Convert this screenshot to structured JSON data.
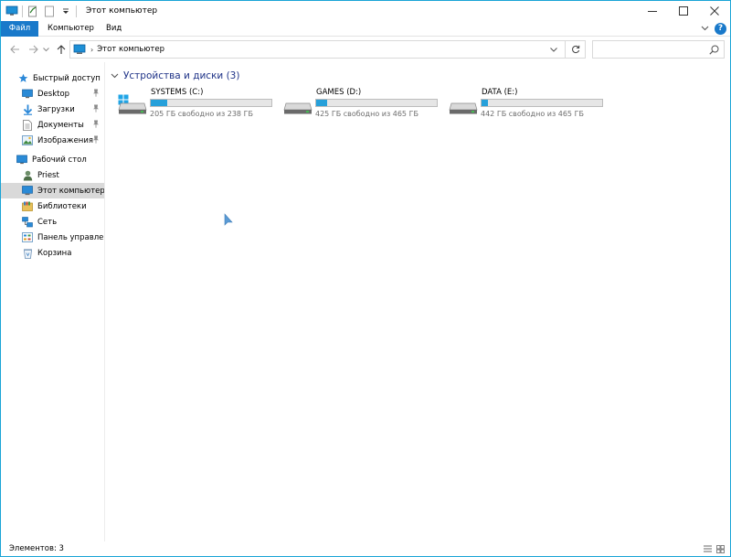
{
  "window": {
    "title": "Этот компьютер",
    "accent": "#1979ca"
  },
  "ribbon": {
    "tabs": [
      "Файл",
      "Компьютер",
      "Вид"
    ],
    "help_label": "?"
  },
  "address": {
    "breadcrumb": "Этот компьютер",
    "search_placeholder": ""
  },
  "sidebar": {
    "quick_access": "Быстрый доступ",
    "items": [
      {
        "label": "Desktop",
        "icon": "desktop-icon",
        "pinned": true
      },
      {
        "label": "Загрузки",
        "icon": "downloads-icon",
        "pinned": true
      },
      {
        "label": "Документы",
        "icon": "documents-icon",
        "pinned": true
      },
      {
        "label": "Изображения",
        "icon": "pictures-icon",
        "pinned": true
      },
      {
        "label": "Рабочий стол",
        "icon": "desktop-icon",
        "pinned": false
      },
      {
        "label": "Priest",
        "icon": "user-icon",
        "pinned": false
      },
      {
        "label": "Этот компьютер",
        "icon": "this-pc-icon",
        "pinned": false,
        "selected": true
      },
      {
        "label": "Библиотеки",
        "icon": "libraries-icon",
        "pinned": false
      },
      {
        "label": "Сеть",
        "icon": "network-icon",
        "pinned": false
      },
      {
        "label": "Панель управлени",
        "icon": "control-panel-icon",
        "pinned": false
      },
      {
        "label": "Корзина",
        "icon": "recycle-bin-icon",
        "pinned": false
      }
    ]
  },
  "content": {
    "group_header": "Устройства и диски (3)",
    "drives": [
      {
        "name": "SYSTEMS (C:)",
        "free": "205 ГБ свободно из 238 ГБ",
        "used_fraction": 0.14,
        "system": true
      },
      {
        "name": "GAMES (D:)",
        "free": "425 ГБ свободно из 465 ГБ",
        "used_fraction": 0.09,
        "system": false
      },
      {
        "name": "DATA (E:)",
        "free": "442 ГБ свободно из 465 ГБ",
        "used_fraction": 0.05,
        "system": false
      }
    ]
  },
  "status": {
    "count": "Элементов: 3"
  },
  "colors": {
    "bar_fill": "#26a0da",
    "bar_bg": "#e6e6e6",
    "group_header": "#1e3287",
    "selection": "#d9d9d9"
  }
}
